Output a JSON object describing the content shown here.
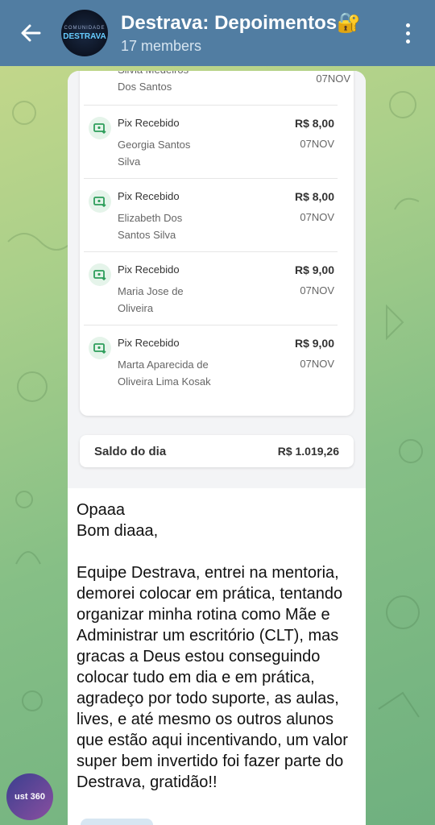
{
  "header": {
    "title": "Destrava: Depoimentos🔐",
    "subtitle": "17 members",
    "avatar_text_small": "COMUNIDADE",
    "avatar_text_large": "DESTRAVA"
  },
  "receipt": {
    "partial_top": {
      "name": "Silvia Medeiros\nDos Santos",
      "date": "07NOV"
    },
    "transactions": [
      {
        "type": "Pix Recebido",
        "name": "Georgia Santos Silva",
        "amount": "R$ 8,00",
        "date": "07NOV"
      },
      {
        "type": "Pix Recebido",
        "name": "Elizabeth Dos Santos Silva",
        "amount": "R$ 8,00",
        "date": "07NOV"
      },
      {
        "type": "Pix Recebido",
        "name": "Maria Jose de Oliveira",
        "amount": "R$ 9,00",
        "date": "07NOV"
      },
      {
        "type": "Pix Recebido",
        "name": "Marta Aparecida de Oliveira Lima Kosak",
        "amount": "R$ 9,00",
        "date": "07NOV"
      }
    ],
    "saldo_label": "Saldo do dia",
    "saldo_value": "R$ 1.019,26"
  },
  "message": {
    "text": "Opaaa\nBom diaaa,\n\nEquipe Destrava, entrei na mentoria, demorei colocar em prática, tentando organizar minha rotina como Mãe e Administrar um escritório (CLT), mas gracas a Deus estou conseguindo colocar tudo em dia e em prática, agradeço por todo suporte, as aulas, lives, e até mesmo os outros alunos que estão aqui incentivando, um valor super bem invertido foi fazer parte do Destrava, gratidão!!"
  },
  "sender": {
    "avatar_text": "ust 360"
  },
  "colors": {
    "header": "#517da2",
    "pix_green": "#2e9e5b"
  }
}
